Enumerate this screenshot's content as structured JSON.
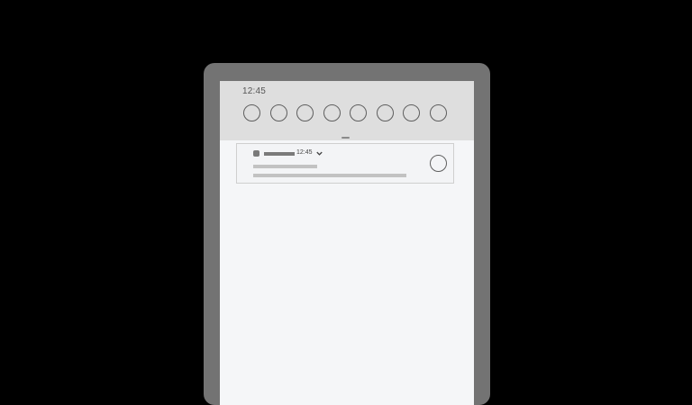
{
  "status_bar": {
    "time": "12:45"
  },
  "quick_settings": {
    "tiles": [
      {
        "icon": "toggle-tile-icon"
      },
      {
        "icon": "toggle-tile-icon"
      },
      {
        "icon": "toggle-tile-icon"
      },
      {
        "icon": "toggle-tile-icon"
      },
      {
        "icon": "toggle-tile-icon"
      },
      {
        "icon": "toggle-tile-icon"
      },
      {
        "icon": "toggle-tile-icon"
      },
      {
        "icon": "toggle-tile-icon"
      }
    ]
  },
  "notification": {
    "time": "12:45",
    "expand_icon": "chevron-down-icon",
    "action_icon": "circle-icon"
  },
  "colors": {
    "background": "#000000",
    "device_frame": "#737373",
    "screen": "#f5f6f8",
    "quick_settings_panel": "#dedede",
    "placeholder_text_line": "#c2c2c2",
    "placeholder_dark": "#7a7a7a"
  }
}
